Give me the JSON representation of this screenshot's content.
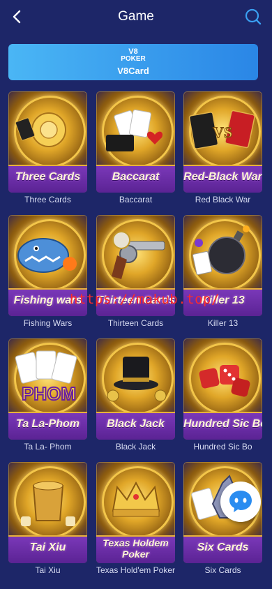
{
  "header": {
    "title": "Game",
    "back_icon": "chevron-left-icon",
    "search_icon": "search-icon"
  },
  "category_tab": {
    "line1": "V8",
    "line2": "POKER",
    "line3": "V8Card"
  },
  "games": [
    {
      "banner": "Three Cards",
      "label": "Three Cards"
    },
    {
      "banner": "Baccarat",
      "label": "Baccarat"
    },
    {
      "banner": "Red-Black War",
      "label": "Red Black War"
    },
    {
      "banner": "Fishing wars",
      "label": "Fishing Wars"
    },
    {
      "banner": "Thirteen Cards",
      "label": "Thirteen Cards"
    },
    {
      "banner": "Killer 13",
      "label": "Killer 13"
    },
    {
      "banner": "Ta La-Phom",
      "label": "Ta La- Phom"
    },
    {
      "banner": "Black Jack",
      "label": "Black Jack"
    },
    {
      "banner": "Hundred Sic Bo",
      "label": "Hundred Sic Bo"
    },
    {
      "banner": "Tai Xiu",
      "label": "Tai Xiu"
    },
    {
      "banner": "Texas Holdem Poker",
      "label": "Texas Hold'em Poker"
    },
    {
      "banner": "Six Cards",
      "label": "Six Cards"
    }
  ],
  "watermark": "https://makub.top/",
  "colors": {
    "background": "#1d2668",
    "tab_accent": "#2a86e6",
    "banner_purple": "#6a2ca6",
    "gold": "#e8b23a"
  }
}
